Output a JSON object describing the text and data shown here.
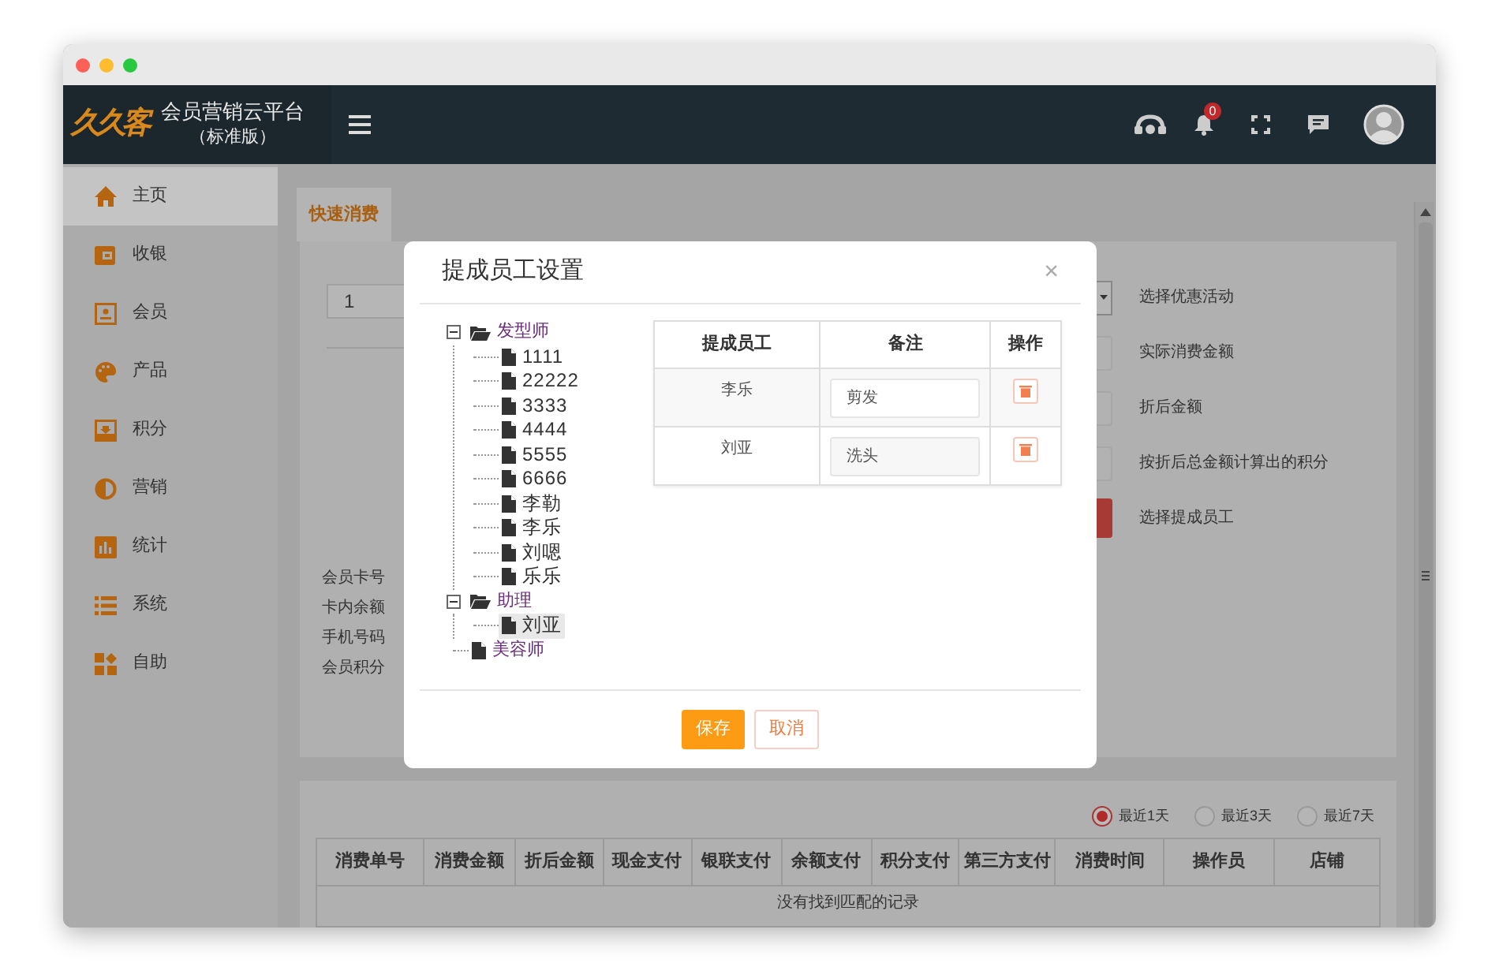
{
  "header": {
    "logo": "久久客",
    "title": "会员营销云平台",
    "edition": "（标准版）",
    "notification_count": "0"
  },
  "sidebar": {
    "items": [
      {
        "label": "主页",
        "selected": true
      },
      {
        "label": "收银",
        "selected": false
      },
      {
        "label": "会员",
        "selected": false
      },
      {
        "label": "产品",
        "selected": false
      },
      {
        "label": "积分",
        "selected": false
      },
      {
        "label": "营销",
        "selected": false
      },
      {
        "label": "统计",
        "selected": false
      },
      {
        "label": "系统",
        "selected": false
      },
      {
        "label": "自助",
        "selected": false
      }
    ]
  },
  "tabs": [
    {
      "label": "快速消费",
      "selected": true
    }
  ],
  "form": {
    "quantity": "1",
    "member_labels": [
      "会员卡号",
      "卡内余额",
      "手机号码",
      "会员积分"
    ],
    "right_labels": [
      "选择优惠活动",
      "实际消费金额",
      "折后金额",
      "按折后总金额计算出的积分",
      "选择提成员工"
    ]
  },
  "records": {
    "ranges": [
      {
        "label": "最近1天",
        "selected": true
      },
      {
        "label": "最近3天",
        "selected": false
      },
      {
        "label": "最近7天",
        "selected": false
      }
    ],
    "columns": [
      "消费单号",
      "消费金额",
      "折后金额",
      "现金支付",
      "银联支付",
      "余额支付",
      "积分支付",
      "第三方支付",
      "消费时间",
      "操作员",
      "店铺"
    ],
    "empty_message": "没有找到匹配的记录"
  },
  "dialog": {
    "title": "提成员工设置",
    "close": "×",
    "tree": [
      {
        "label": "发型师",
        "expanded": true,
        "selected": false,
        "children": [
          {
            "label": "1111",
            "selected": false
          },
          {
            "label": "22222",
            "selected": false
          },
          {
            "label": "3333",
            "selected": false
          },
          {
            "label": "4444",
            "selected": false
          },
          {
            "label": "5555",
            "selected": false
          },
          {
            "label": "6666",
            "selected": false
          },
          {
            "label": "李勒",
            "selected": false
          },
          {
            "label": "李乐",
            "selected": false
          },
          {
            "label": "刘嗯",
            "selected": false
          },
          {
            "label": "乐乐",
            "selected": false
          }
        ]
      },
      {
        "label": "助理",
        "expanded": true,
        "selected": false,
        "children": [
          {
            "label": "刘亚",
            "selected": true
          }
        ]
      },
      {
        "label": "美容师",
        "selected": false
      }
    ],
    "table": {
      "columns": [
        "提成员工",
        "备注",
        "操作"
      ],
      "rows": [
        {
          "employee": "李乐",
          "note": "剪发"
        },
        {
          "employee": "刘亚",
          "note": "洗头"
        }
      ]
    },
    "buttons": [
      "保存",
      "取消"
    ]
  }
}
